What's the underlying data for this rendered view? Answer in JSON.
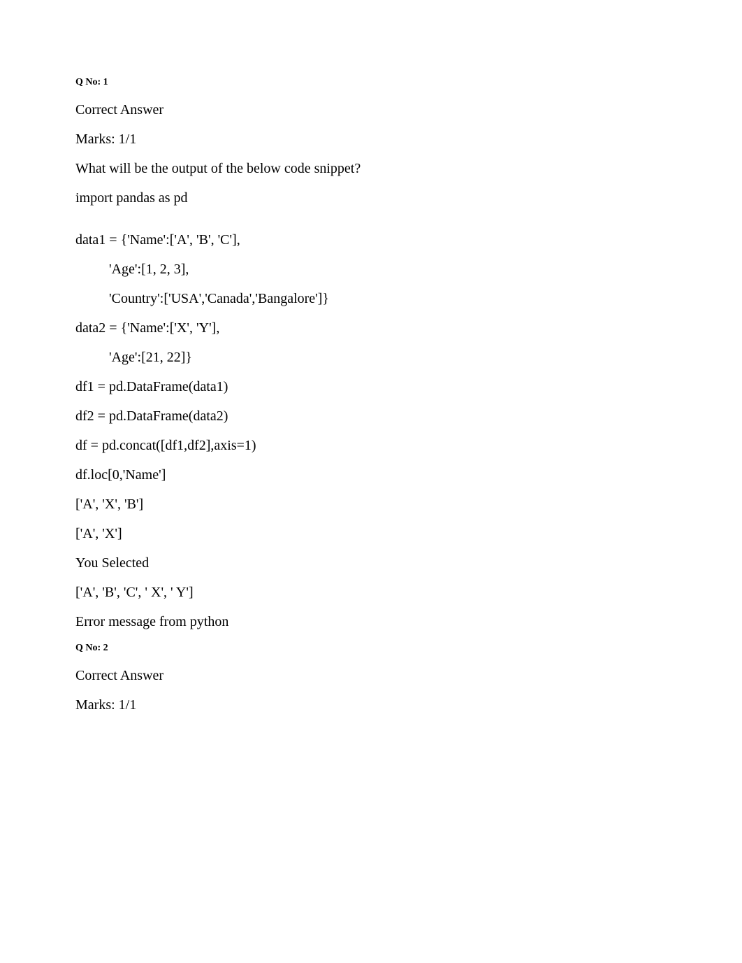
{
  "q1": {
    "heading": "Q No: 1",
    "status": "Correct Answer",
    "marks": "Marks: 1/1",
    "question": "What will be the output of the below code snippet?",
    "code": {
      "l1": "import pandas as pd",
      "l2": "data1 = {'Name':['A', 'B', 'C'],",
      "l3": "'Age':[1, 2, 3],",
      "l4": "'Country':['USA','Canada','Bangalore']}",
      "l5": "data2 = {'Name':['X', 'Y'],",
      "l6": "'Age':[21, 22]}",
      "l7": "df1 = pd.DataFrame(data1)",
      "l8": "df2 = pd.DataFrame(data2)",
      "l9": "df = pd.concat([df1,df2],axis=1)",
      "l10": "df.loc[0,'Name']"
    },
    "opt1": "['A', 'X', 'B']",
    "opt2": "['A', 'X']",
    "selected_label": "You Selected",
    "opt3": "['A', 'B', 'C', ' X', ' Y']",
    "opt4": "Error message from python"
  },
  "q2": {
    "heading": "Q No: 2",
    "status": "Correct Answer",
    "marks": "Marks: 1/1"
  }
}
